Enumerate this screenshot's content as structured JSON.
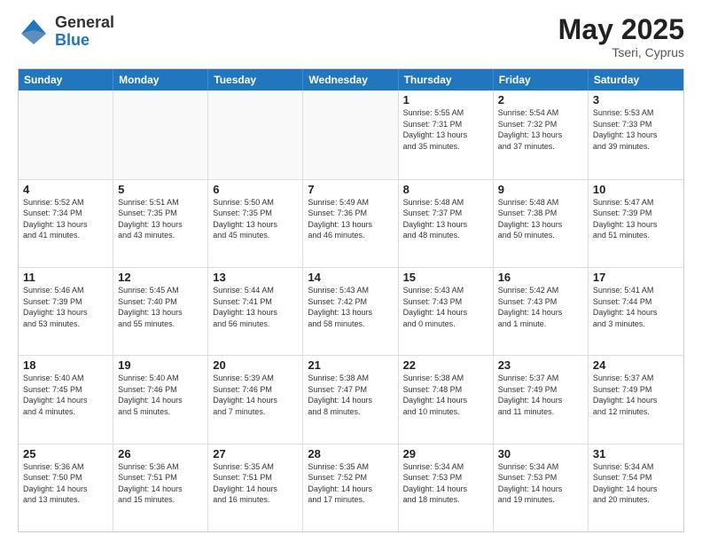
{
  "header": {
    "logo_general": "General",
    "logo_blue": "Blue",
    "month_title": "May 2025",
    "location": "Tseri, Cyprus"
  },
  "weekdays": [
    "Sunday",
    "Monday",
    "Tuesday",
    "Wednesday",
    "Thursday",
    "Friday",
    "Saturday"
  ],
  "weeks": [
    [
      {
        "day": "",
        "text": "",
        "empty": true
      },
      {
        "day": "",
        "text": "",
        "empty": true
      },
      {
        "day": "",
        "text": "",
        "empty": true
      },
      {
        "day": "",
        "text": "",
        "empty": true
      },
      {
        "day": "1",
        "text": "Sunrise: 5:55 AM\nSunset: 7:31 PM\nDaylight: 13 hours\nand 35 minutes.",
        "empty": false
      },
      {
        "day": "2",
        "text": "Sunrise: 5:54 AM\nSunset: 7:32 PM\nDaylight: 13 hours\nand 37 minutes.",
        "empty": false
      },
      {
        "day": "3",
        "text": "Sunrise: 5:53 AM\nSunset: 7:33 PM\nDaylight: 13 hours\nand 39 minutes.",
        "empty": false
      }
    ],
    [
      {
        "day": "4",
        "text": "Sunrise: 5:52 AM\nSunset: 7:34 PM\nDaylight: 13 hours\nand 41 minutes.",
        "empty": false
      },
      {
        "day": "5",
        "text": "Sunrise: 5:51 AM\nSunset: 7:35 PM\nDaylight: 13 hours\nand 43 minutes.",
        "empty": false
      },
      {
        "day": "6",
        "text": "Sunrise: 5:50 AM\nSunset: 7:35 PM\nDaylight: 13 hours\nand 45 minutes.",
        "empty": false
      },
      {
        "day": "7",
        "text": "Sunrise: 5:49 AM\nSunset: 7:36 PM\nDaylight: 13 hours\nand 46 minutes.",
        "empty": false
      },
      {
        "day": "8",
        "text": "Sunrise: 5:48 AM\nSunset: 7:37 PM\nDaylight: 13 hours\nand 48 minutes.",
        "empty": false
      },
      {
        "day": "9",
        "text": "Sunrise: 5:48 AM\nSunset: 7:38 PM\nDaylight: 13 hours\nand 50 minutes.",
        "empty": false
      },
      {
        "day": "10",
        "text": "Sunrise: 5:47 AM\nSunset: 7:39 PM\nDaylight: 13 hours\nand 51 minutes.",
        "empty": false
      }
    ],
    [
      {
        "day": "11",
        "text": "Sunrise: 5:46 AM\nSunset: 7:39 PM\nDaylight: 13 hours\nand 53 minutes.",
        "empty": false
      },
      {
        "day": "12",
        "text": "Sunrise: 5:45 AM\nSunset: 7:40 PM\nDaylight: 13 hours\nand 55 minutes.",
        "empty": false
      },
      {
        "day": "13",
        "text": "Sunrise: 5:44 AM\nSunset: 7:41 PM\nDaylight: 13 hours\nand 56 minutes.",
        "empty": false
      },
      {
        "day": "14",
        "text": "Sunrise: 5:43 AM\nSunset: 7:42 PM\nDaylight: 13 hours\nand 58 minutes.",
        "empty": false
      },
      {
        "day": "15",
        "text": "Sunrise: 5:43 AM\nSunset: 7:43 PM\nDaylight: 14 hours\nand 0 minutes.",
        "empty": false
      },
      {
        "day": "16",
        "text": "Sunrise: 5:42 AM\nSunset: 7:43 PM\nDaylight: 14 hours\nand 1 minute.",
        "empty": false
      },
      {
        "day": "17",
        "text": "Sunrise: 5:41 AM\nSunset: 7:44 PM\nDaylight: 14 hours\nand 3 minutes.",
        "empty": false
      }
    ],
    [
      {
        "day": "18",
        "text": "Sunrise: 5:40 AM\nSunset: 7:45 PM\nDaylight: 14 hours\nand 4 minutes.",
        "empty": false
      },
      {
        "day": "19",
        "text": "Sunrise: 5:40 AM\nSunset: 7:46 PM\nDaylight: 14 hours\nand 5 minutes.",
        "empty": false
      },
      {
        "day": "20",
        "text": "Sunrise: 5:39 AM\nSunset: 7:46 PM\nDaylight: 14 hours\nand 7 minutes.",
        "empty": false
      },
      {
        "day": "21",
        "text": "Sunrise: 5:38 AM\nSunset: 7:47 PM\nDaylight: 14 hours\nand 8 minutes.",
        "empty": false
      },
      {
        "day": "22",
        "text": "Sunrise: 5:38 AM\nSunset: 7:48 PM\nDaylight: 14 hours\nand 10 minutes.",
        "empty": false
      },
      {
        "day": "23",
        "text": "Sunrise: 5:37 AM\nSunset: 7:49 PM\nDaylight: 14 hours\nand 11 minutes.",
        "empty": false
      },
      {
        "day": "24",
        "text": "Sunrise: 5:37 AM\nSunset: 7:49 PM\nDaylight: 14 hours\nand 12 minutes.",
        "empty": false
      }
    ],
    [
      {
        "day": "25",
        "text": "Sunrise: 5:36 AM\nSunset: 7:50 PM\nDaylight: 14 hours\nand 13 minutes.",
        "empty": false
      },
      {
        "day": "26",
        "text": "Sunrise: 5:36 AM\nSunset: 7:51 PM\nDaylight: 14 hours\nand 15 minutes.",
        "empty": false
      },
      {
        "day": "27",
        "text": "Sunrise: 5:35 AM\nSunset: 7:51 PM\nDaylight: 14 hours\nand 16 minutes.",
        "empty": false
      },
      {
        "day": "28",
        "text": "Sunrise: 5:35 AM\nSunset: 7:52 PM\nDaylight: 14 hours\nand 17 minutes.",
        "empty": false
      },
      {
        "day": "29",
        "text": "Sunrise: 5:34 AM\nSunset: 7:53 PM\nDaylight: 14 hours\nand 18 minutes.",
        "empty": false
      },
      {
        "day": "30",
        "text": "Sunrise: 5:34 AM\nSunset: 7:53 PM\nDaylight: 14 hours\nand 19 minutes.",
        "empty": false
      },
      {
        "day": "31",
        "text": "Sunrise: 5:34 AM\nSunset: 7:54 PM\nDaylight: 14 hours\nand 20 minutes.",
        "empty": false
      }
    ]
  ]
}
